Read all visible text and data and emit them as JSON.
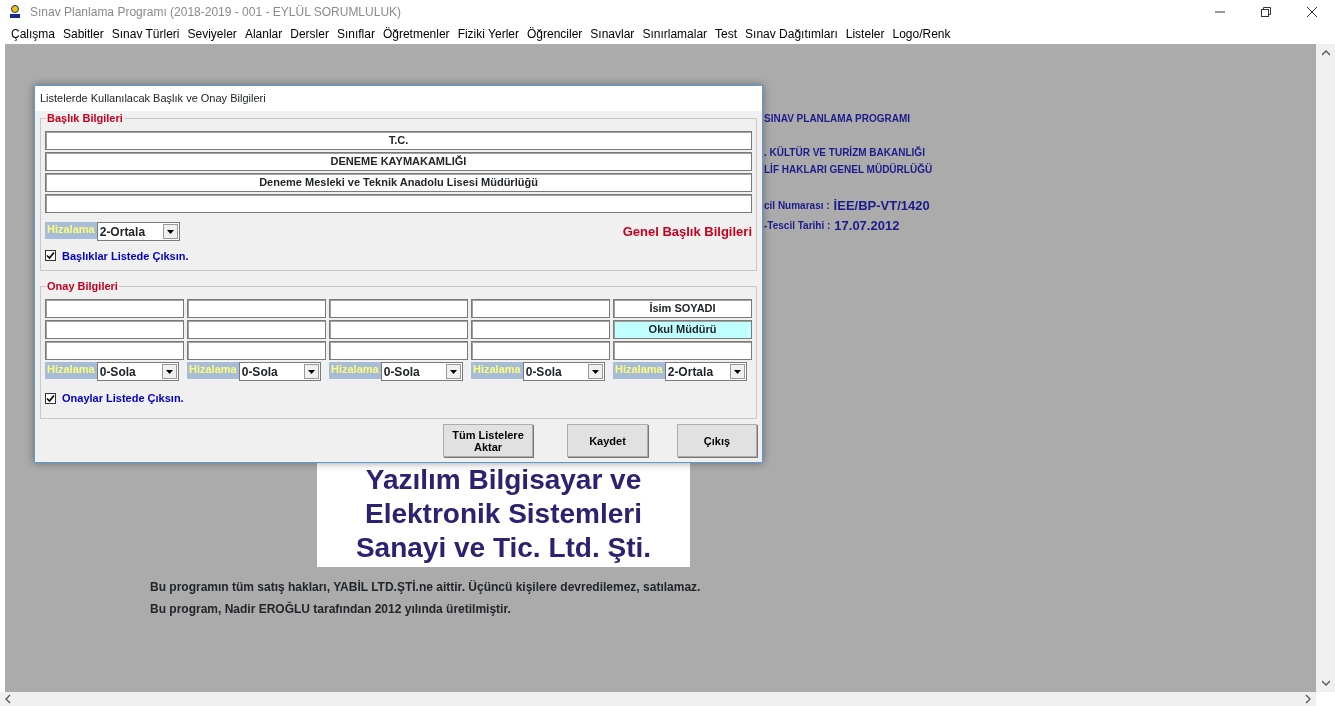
{
  "window": {
    "title": "Sınav Planlama Programı (2018-2019 - 001 - EYLÜL SORUMLULUK)"
  },
  "menu": [
    "Çalışma",
    "Sabitler",
    "Sınav Türleri",
    "Seviyeler",
    "Alanlar",
    "Dersler",
    "Sınıflar",
    "Öğretmenler",
    "Fiziki Yerler",
    "Öğrenciler",
    "Sınavlar",
    "Sınırlamalar",
    "Test",
    "Sınav Dağıtımları",
    "Listeler",
    "Logo/Renk"
  ],
  "background": {
    "info_lines": [
      {
        "kind": "plain",
        "text": "SINAV PLANLAMA PROGRAMI"
      },
      {
        "kind": "gap"
      },
      {
        "kind": "plain",
        "text": ". KÜLTÜR VE TURİZM BAKANLIĞI"
      },
      {
        "kind": "plain",
        "text": "LİF HAKLARI GENEL MÜDÜRLÜĞÜ"
      },
      {
        "kind": "gap"
      },
      {
        "kind": "pair",
        "label": "cil Numarası :",
        "value": "İEE/BP-VT/1420"
      },
      {
        "kind": "pair",
        "label": "-Tescil Tarihi :",
        "value": "17.07.2012"
      }
    ],
    "company_lines": [
      "Yazılım Bilgisayar ve",
      "Elektronik Sistemleri",
      "Sanayi ve Tic. Ltd. Şti."
    ],
    "notices": [
      "Bu programın tüm satış hakları, YABİL LTD.ŞTİ.ne aittir. Üçüncü kişilere devredilemez, satılamaz.",
      "Bu program, Nadir EROĞLU tarafından 2012 yılında üretilmiştir."
    ]
  },
  "dialog": {
    "title": "Listelerde Kullanılacak Başlık ve Onay Bilgileri",
    "header_group": {
      "legend": "Başlık Bilgileri",
      "fields": [
        {
          "value": "T.C.",
          "highlighted": false
        },
        {
          "value": "DENEME KAYMAKAMLIĞI",
          "highlighted": false
        },
        {
          "value": "Deneme Mesleki ve Teknik Anadolu Lisesi Müdürlüğü",
          "highlighted": false
        },
        {
          "highlighted": false
        }
      ],
      "align_label": "Hizalama",
      "align_value": "2-Ortala",
      "note": "Genel Başlık Bilgileri",
      "checkbox": {
        "label": "Başlıklar Listede Çıksın.",
        "checked": true
      }
    },
    "approval_group": {
      "legend": "Onay Bilgileri",
      "columns": [
        {
          "fields": [
            {
              "highlighted": false
            },
            {
              "highlighted": false
            },
            {
              "highlighted": false
            }
          ],
          "align_label": "Hizalama",
          "align_value": "0-Sola"
        },
        {
          "fields": [
            {
              "highlighted": false
            },
            {
              "highlighted": false
            },
            {
              "highlighted": false
            }
          ],
          "align_label": "Hizalama",
          "align_value": "0-Sola"
        },
        {
          "fields": [
            {
              "highlighted": false
            },
            {
              "highlighted": false
            },
            {
              "highlighted": false
            }
          ],
          "align_label": "Hizalama",
          "align_value": "0-Sola"
        },
        {
          "fields": [
            {
              "highlighted": false
            },
            {
              "highlighted": false
            },
            {
              "highlighted": false
            }
          ],
          "align_label": "Hizalama",
          "align_value": "0-Sola"
        },
        {
          "fields": [
            {
              "value": "İsim SOYADI",
              "highlighted": false
            },
            {
              "value": "Okul Müdürü",
              "highlighted": true
            },
            {
              "highlighted": false
            }
          ],
          "align_label": "Hizalama",
          "align_value": "2-Ortala"
        }
      ],
      "checkbox": {
        "label": "Onaylar Listede Çıksın.",
        "checked": true
      }
    },
    "buttons": [
      "Tüm Listelere Aktar",
      "Kaydet",
      "Çıkış"
    ]
  }
}
